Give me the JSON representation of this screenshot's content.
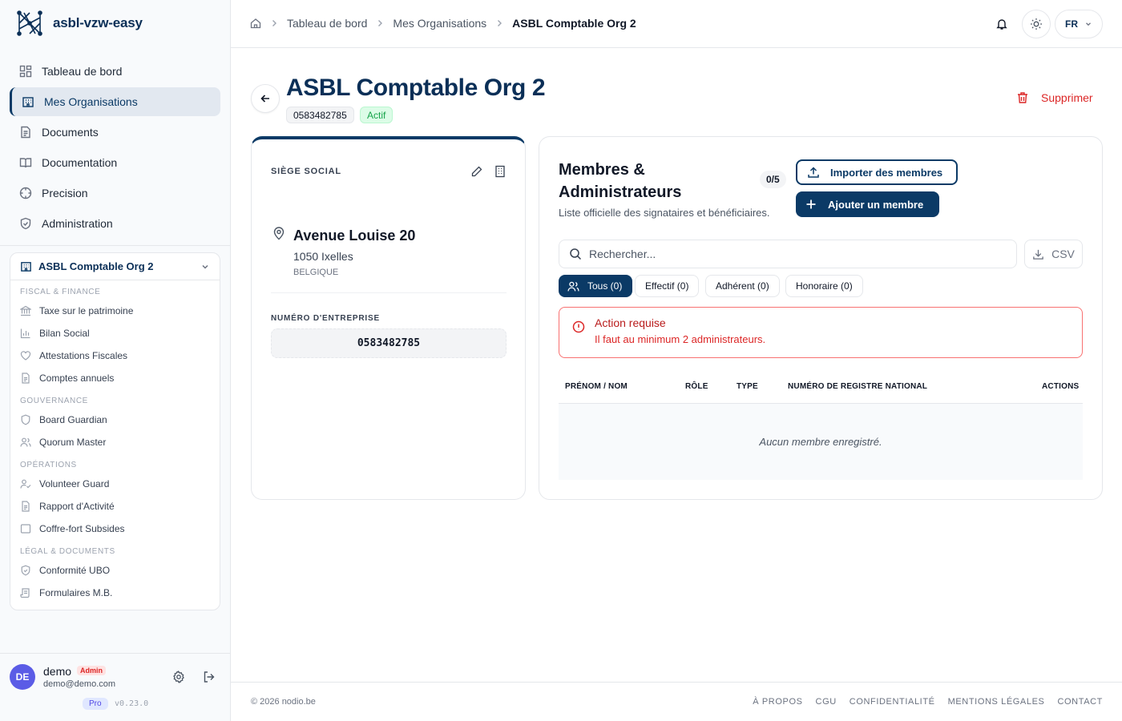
{
  "brand": {
    "name": "asbl-vzw-easy"
  },
  "nav": {
    "items": [
      {
        "label": "Tableau de bord",
        "icon": "dashboard-icon"
      },
      {
        "label": "Mes Organisations",
        "icon": "building-icon",
        "active": true
      },
      {
        "label": "Documents",
        "icon": "document-icon"
      },
      {
        "label": "Documentation",
        "icon": "book-icon"
      },
      {
        "label": "Precision",
        "icon": "crosshair-icon"
      },
      {
        "label": "Administration",
        "icon": "shield-icon"
      }
    ]
  },
  "org_menu": {
    "name": "ASBL Comptable Org 2",
    "sections": [
      {
        "title": "FISCAL & FINANCE",
        "items": [
          "Taxe sur le patrimoine",
          "Bilan Social",
          "Attestations Fiscales",
          "Comptes annuels"
        ]
      },
      {
        "title": "GOUVERNANCE",
        "items": [
          "Board Guardian",
          "Quorum Master"
        ]
      },
      {
        "title": "OPÉRATIONS",
        "items": [
          "Volunteer Guard",
          "Rapport d'Activité",
          "Coffre-fort Subsides"
        ]
      },
      {
        "title": "LÉGAL & DOCUMENTS",
        "items": [
          "Conformité UBO",
          "Formulaires M.B."
        ]
      }
    ]
  },
  "user": {
    "initials": "DE",
    "name": "demo",
    "role": "Admin",
    "email": "demo@demo.com",
    "plan": "Pro",
    "version": "v0.23.0"
  },
  "breadcrumb": {
    "level1": "Tableau de bord",
    "level2": "Mes Organisations",
    "current": "ASBL Comptable Org 2"
  },
  "topbar": {
    "language": "FR"
  },
  "page": {
    "title": "ASBL Comptable Org 2",
    "number": "0583482785",
    "status": "Actif",
    "delete_label": "Supprimer"
  },
  "siege": {
    "title": "SIÈGE SOCIAL",
    "street": "Avenue Louise 20",
    "city": "1050 Ixelles",
    "country": "BELGIQUE",
    "number_label": "NUMÉRO D'ENTREPRISE",
    "number": "0583482785"
  },
  "members": {
    "title_line1": "Membres &",
    "title_line2": "Administrateurs",
    "count": "0/5",
    "subtitle": "Liste officielle des signataires et bénéficiaires.",
    "import_label": "Importer des membres",
    "add_label": "Ajouter un membre",
    "search_placeholder": "Rechercher...",
    "csv_label": "CSV",
    "filters": [
      "Tous (0)",
      "Effectif (0)",
      "Adhérent (0)",
      "Honoraire (0)"
    ],
    "alert_title": "Action requise",
    "alert_text": "Il faut au minimum 2 administrateurs.",
    "columns": [
      "PRÉNOM / NOM",
      "RÔLE",
      "TYPE",
      "NUMÉRO DE REGISTRE NATIONAL",
      "ACTIONS"
    ],
    "empty_text": "Aucun membre enregistré."
  },
  "footer": {
    "copyright": "© 2026 nodio.be",
    "links": [
      "À PROPOS",
      "CGU",
      "CONFIDENTIALITÉ",
      "MENTIONS LÉGALES",
      "CONTACT"
    ]
  },
  "colors": {
    "primary": "#0b3a66",
    "danger": "#dc2626",
    "success_bg": "#dcfce7",
    "avatar": "#5b5ce6"
  }
}
